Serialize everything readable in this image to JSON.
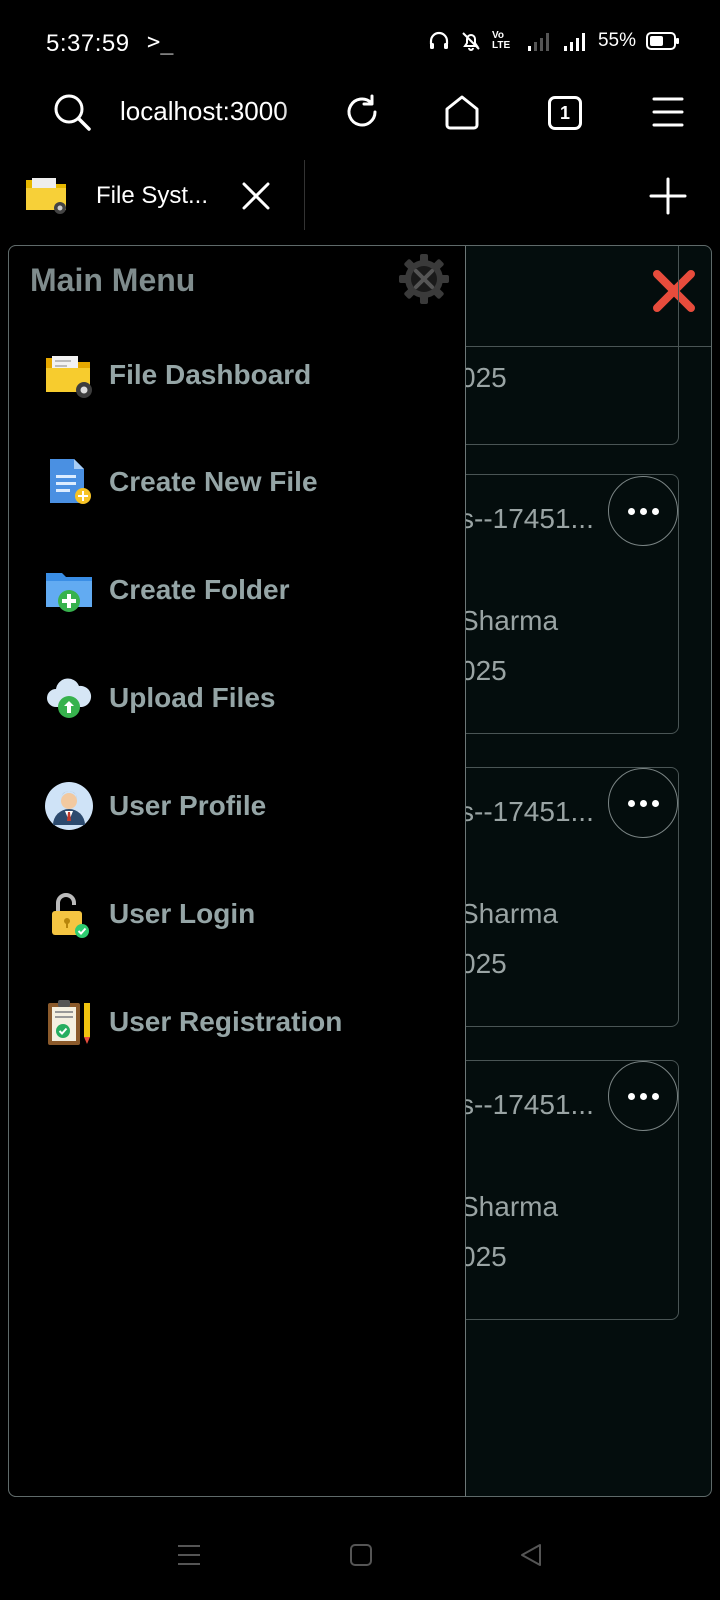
{
  "status_bar": {
    "time": "5:37:59",
    "terminal_glyph": ">_",
    "battery_percent": "55%",
    "network_label": "Vo LTE"
  },
  "browser": {
    "url": "localhost:3000",
    "tab_count": "1",
    "tab_title": "File Syst..."
  },
  "drawer": {
    "title": "Main Menu",
    "items": [
      {
        "label": "File Dashboard",
        "icon": "folder-gear-icon"
      },
      {
        "label": "Create New File",
        "icon": "new-file-icon"
      },
      {
        "label": "Create Folder",
        "icon": "add-folder-icon"
      },
      {
        "label": "Upload Files",
        "icon": "cloud-upload-icon"
      },
      {
        "label": "User Profile",
        "icon": "user-avatar-icon"
      },
      {
        "label": "User Login",
        "icon": "padlock-icon"
      },
      {
        "label": "User Registration",
        "icon": "clipboard-icon"
      }
    ]
  },
  "background_cards": [
    {
      "line1": "",
      "line2": "",
      "line3": "025"
    },
    {
      "line1": "s--17451...",
      "line2": "Sharma",
      "line3": "025"
    },
    {
      "line1": "s--17451...",
      "line2": "Sharma",
      "line3": "025"
    },
    {
      "line1": "s--17451...",
      "line2": "Sharma",
      "line3": "025"
    }
  ],
  "colors": {
    "close_accent": "#e74c3c",
    "menu_text": "#95a5a6",
    "title_text": "#7f8c8d"
  }
}
